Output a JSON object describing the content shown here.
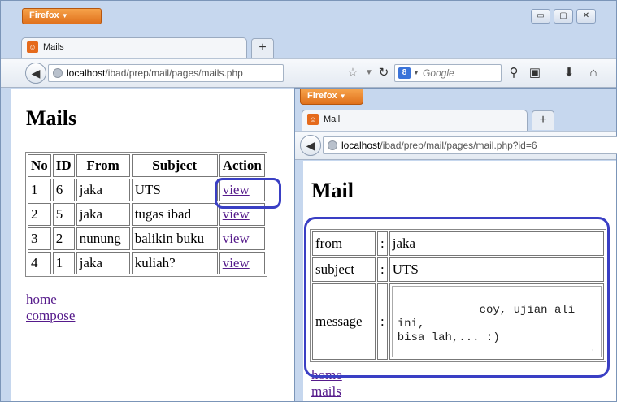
{
  "back_window": {
    "app_button": "Firefox",
    "window_controls": {
      "minimize": "▭",
      "maximize": "▢",
      "close": "✕"
    },
    "tab": {
      "favicon": "firefox-page-icon",
      "label": "Mails"
    },
    "new_tab": "+",
    "url": {
      "host": "localhost",
      "path": "/ibad/prep/mail/pages/mails.php"
    },
    "search": {
      "engine": "8",
      "placeholder": "Google"
    },
    "page": {
      "title": "Mails",
      "table": {
        "headers": [
          "No",
          "ID",
          "From",
          "Subject",
          "Action"
        ],
        "rows": [
          {
            "no": "1",
            "id": "6",
            "from": "jaka",
            "subject": "UTS",
            "action": "view"
          },
          {
            "no": "2",
            "id": "5",
            "from": "jaka",
            "subject": "tugas ibad",
            "action": "view"
          },
          {
            "no": "3",
            "id": "2",
            "from": "nunung",
            "subject": "balikin buku",
            "action": "view"
          },
          {
            "no": "4",
            "id": "1",
            "from": "jaka",
            "subject": "kuliah?",
            "action": "view"
          }
        ]
      },
      "links": [
        "home",
        "compose"
      ]
    }
  },
  "front_window": {
    "app_button": "Firefox",
    "tab": {
      "favicon": "firefox-page-icon",
      "label": "Mail"
    },
    "new_tab": "+",
    "url": {
      "host": "localhost",
      "path": "/ibad/prep/mail/pages/mail.php?id=6"
    },
    "page": {
      "title": "Mail",
      "fields": {
        "from_label": "from",
        "from_value": "jaka",
        "subject_label": "subject",
        "subject_value": "UTS",
        "message_label": "message",
        "message_value": "coy, ujian ali ini,\nbisa lah,... :)",
        "separator": ":"
      },
      "links": [
        "home",
        "mails"
      ]
    }
  },
  "colors": {
    "highlight": "#3a3fc4",
    "firefox_orange": "#e0711c",
    "visited_link": "#551a8b"
  }
}
